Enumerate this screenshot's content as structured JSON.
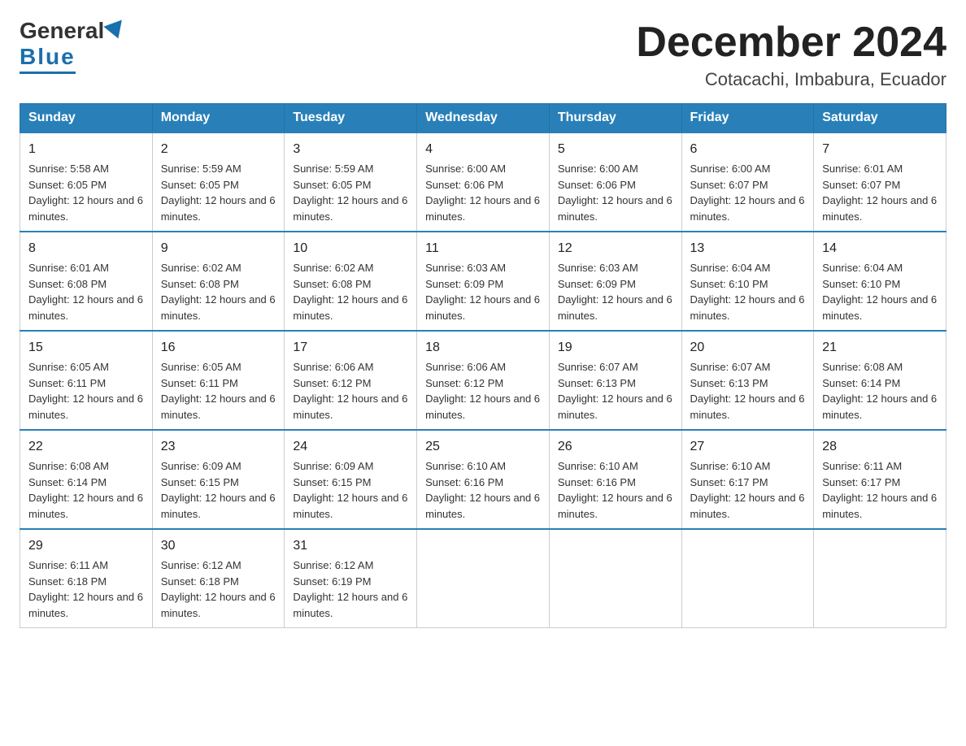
{
  "header": {
    "logo_general": "General",
    "logo_triangle": "▲",
    "logo_blue": "Blue",
    "month_title": "December 2024",
    "location": "Cotacachi, Imbabura, Ecuador"
  },
  "days_of_week": [
    "Sunday",
    "Monday",
    "Tuesday",
    "Wednesday",
    "Thursday",
    "Friday",
    "Saturday"
  ],
  "weeks": [
    [
      {
        "day": "1",
        "sunrise": "5:58 AM",
        "sunset": "6:05 PM",
        "daylight": "12 hours and 6 minutes."
      },
      {
        "day": "2",
        "sunrise": "5:59 AM",
        "sunset": "6:05 PM",
        "daylight": "12 hours and 6 minutes."
      },
      {
        "day": "3",
        "sunrise": "5:59 AM",
        "sunset": "6:05 PM",
        "daylight": "12 hours and 6 minutes."
      },
      {
        "day": "4",
        "sunrise": "6:00 AM",
        "sunset": "6:06 PM",
        "daylight": "12 hours and 6 minutes."
      },
      {
        "day": "5",
        "sunrise": "6:00 AM",
        "sunset": "6:06 PM",
        "daylight": "12 hours and 6 minutes."
      },
      {
        "day": "6",
        "sunrise": "6:00 AM",
        "sunset": "6:07 PM",
        "daylight": "12 hours and 6 minutes."
      },
      {
        "day": "7",
        "sunrise": "6:01 AM",
        "sunset": "6:07 PM",
        "daylight": "12 hours and 6 minutes."
      }
    ],
    [
      {
        "day": "8",
        "sunrise": "6:01 AM",
        "sunset": "6:08 PM",
        "daylight": "12 hours and 6 minutes."
      },
      {
        "day": "9",
        "sunrise": "6:02 AM",
        "sunset": "6:08 PM",
        "daylight": "12 hours and 6 minutes."
      },
      {
        "day": "10",
        "sunrise": "6:02 AM",
        "sunset": "6:08 PM",
        "daylight": "12 hours and 6 minutes."
      },
      {
        "day": "11",
        "sunrise": "6:03 AM",
        "sunset": "6:09 PM",
        "daylight": "12 hours and 6 minutes."
      },
      {
        "day": "12",
        "sunrise": "6:03 AM",
        "sunset": "6:09 PM",
        "daylight": "12 hours and 6 minutes."
      },
      {
        "day": "13",
        "sunrise": "6:04 AM",
        "sunset": "6:10 PM",
        "daylight": "12 hours and 6 minutes."
      },
      {
        "day": "14",
        "sunrise": "6:04 AM",
        "sunset": "6:10 PM",
        "daylight": "12 hours and 6 minutes."
      }
    ],
    [
      {
        "day": "15",
        "sunrise": "6:05 AM",
        "sunset": "6:11 PM",
        "daylight": "12 hours and 6 minutes."
      },
      {
        "day": "16",
        "sunrise": "6:05 AM",
        "sunset": "6:11 PM",
        "daylight": "12 hours and 6 minutes."
      },
      {
        "day": "17",
        "sunrise": "6:06 AM",
        "sunset": "6:12 PM",
        "daylight": "12 hours and 6 minutes."
      },
      {
        "day": "18",
        "sunrise": "6:06 AM",
        "sunset": "6:12 PM",
        "daylight": "12 hours and 6 minutes."
      },
      {
        "day": "19",
        "sunrise": "6:07 AM",
        "sunset": "6:13 PM",
        "daylight": "12 hours and 6 minutes."
      },
      {
        "day": "20",
        "sunrise": "6:07 AM",
        "sunset": "6:13 PM",
        "daylight": "12 hours and 6 minutes."
      },
      {
        "day": "21",
        "sunrise": "6:08 AM",
        "sunset": "6:14 PM",
        "daylight": "12 hours and 6 minutes."
      }
    ],
    [
      {
        "day": "22",
        "sunrise": "6:08 AM",
        "sunset": "6:14 PM",
        "daylight": "12 hours and 6 minutes."
      },
      {
        "day": "23",
        "sunrise": "6:09 AM",
        "sunset": "6:15 PM",
        "daylight": "12 hours and 6 minutes."
      },
      {
        "day": "24",
        "sunrise": "6:09 AM",
        "sunset": "6:15 PM",
        "daylight": "12 hours and 6 minutes."
      },
      {
        "day": "25",
        "sunrise": "6:10 AM",
        "sunset": "6:16 PM",
        "daylight": "12 hours and 6 minutes."
      },
      {
        "day": "26",
        "sunrise": "6:10 AM",
        "sunset": "6:16 PM",
        "daylight": "12 hours and 6 minutes."
      },
      {
        "day": "27",
        "sunrise": "6:10 AM",
        "sunset": "6:17 PM",
        "daylight": "12 hours and 6 minutes."
      },
      {
        "day": "28",
        "sunrise": "6:11 AM",
        "sunset": "6:17 PM",
        "daylight": "12 hours and 6 minutes."
      }
    ],
    [
      {
        "day": "29",
        "sunrise": "6:11 AM",
        "sunset": "6:18 PM",
        "daylight": "12 hours and 6 minutes."
      },
      {
        "day": "30",
        "sunrise": "6:12 AM",
        "sunset": "6:18 PM",
        "daylight": "12 hours and 6 minutes."
      },
      {
        "day": "31",
        "sunrise": "6:12 AM",
        "sunset": "6:19 PM",
        "daylight": "12 hours and 6 minutes."
      },
      null,
      null,
      null,
      null
    ]
  ]
}
